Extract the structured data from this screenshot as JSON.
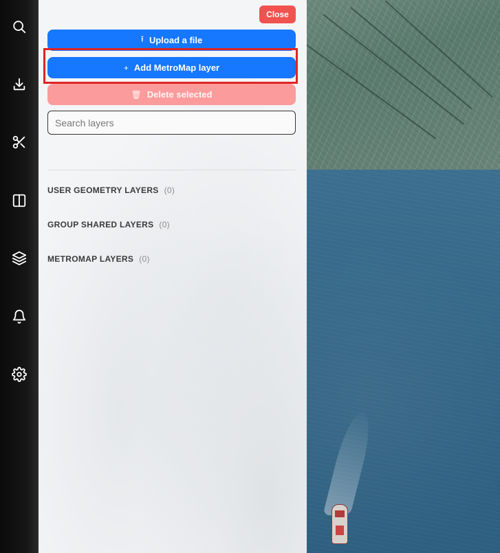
{
  "panel": {
    "close_label": "Close",
    "upload_label": "Upload a file",
    "upload_icon": "upload-icon",
    "add_label": "Add MetroMap layer",
    "add_icon": "plus-icon",
    "delete_label": "Delete selected",
    "delete_icon": "trash-icon",
    "search_placeholder": "Search layers",
    "search_value": "",
    "sections": [
      {
        "label": "USER GEOMETRY LAYERS",
        "count": "(0)"
      },
      {
        "label": "GROUP SHARED LAYERS",
        "count": "(0)"
      },
      {
        "label": "METROMAP LAYERS",
        "count": "(0)"
      }
    ]
  },
  "rail": {
    "icons": [
      "search-icon",
      "download-icon",
      "scissors-icon",
      "split-view-icon",
      "layers-icon",
      "bell-icon",
      "gear-icon"
    ]
  },
  "colors": {
    "primary": "#1677ff",
    "danger": "#f0534f",
    "danger_disabled": "#fb9b9b",
    "highlight": "#e02424"
  }
}
